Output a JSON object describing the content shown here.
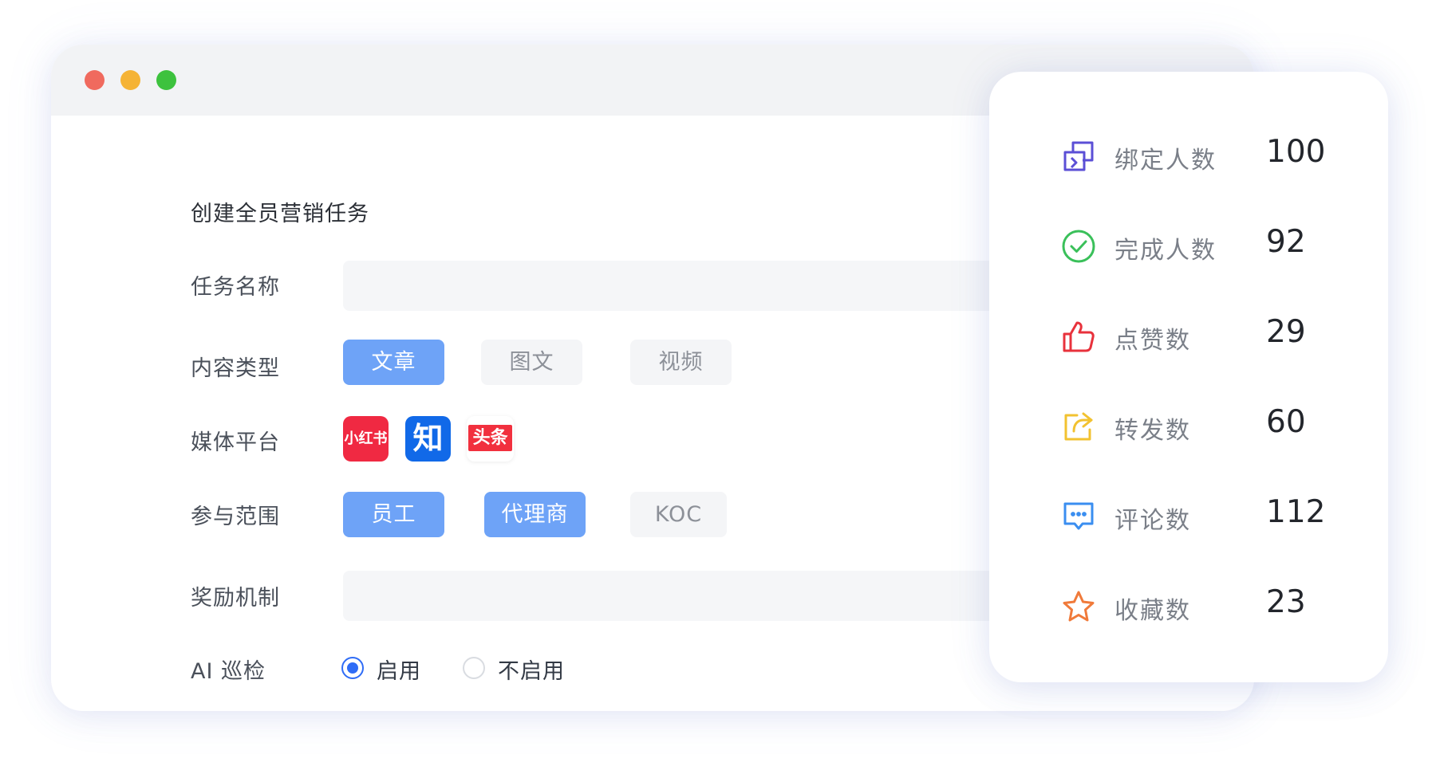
{
  "window": {
    "controls": [
      "close",
      "minimize",
      "maximize"
    ]
  },
  "form": {
    "title": "创建全员营销任务",
    "fields": {
      "task_name": {
        "label": "任务名称",
        "value": ""
      },
      "content_type": {
        "label": "内容类型",
        "options": [
          {
            "label": "文章",
            "selected": true
          },
          {
            "label": "图文",
            "selected": false
          },
          {
            "label": "视频",
            "selected": false
          }
        ]
      },
      "media_platform": {
        "label": "媒体平台",
        "platforms": [
          {
            "name": "xiaohongshu-icon",
            "logo_text": "小红书",
            "color": "#f02942"
          },
          {
            "name": "zhihu-icon",
            "logo_text": "知",
            "color": "#1169e8"
          },
          {
            "name": "toutiao-icon",
            "logo_text": "头条",
            "color": "#f1303e"
          }
        ]
      },
      "scope": {
        "label": "参与范围",
        "options": [
          {
            "label": "员工",
            "selected": true
          },
          {
            "label": "代理商",
            "selected": true
          },
          {
            "label": "KOC",
            "selected": false
          }
        ]
      },
      "reward": {
        "label": "奖励机制",
        "value": ""
      },
      "ai_check": {
        "label": "AI 巡检",
        "options": [
          {
            "label": "启用",
            "selected": true
          },
          {
            "label": "不启用",
            "selected": false
          }
        ]
      }
    }
  },
  "stats": [
    {
      "icon": "bind-icon",
      "label": "绑定人数",
      "value": "100",
      "color": "#5b4fd6"
    },
    {
      "icon": "check-circle-icon",
      "label": "完成人数",
      "value": "92",
      "color": "#3ac05a"
    },
    {
      "icon": "thumbs-up-icon",
      "label": "点赞数",
      "value": "29",
      "color": "#e8323c"
    },
    {
      "icon": "share-icon",
      "label": "转发数",
      "value": "60",
      "color": "#f2c230"
    },
    {
      "icon": "comment-icon",
      "label": "评论数",
      "value": "112",
      "color": "#3a8ef0"
    },
    {
      "icon": "star-icon",
      "label": "收藏数",
      "value": "23",
      "color": "#f07a3a"
    }
  ],
  "colors": {
    "accent": "#6ea3f7",
    "radio": "#2f6cf6"
  }
}
